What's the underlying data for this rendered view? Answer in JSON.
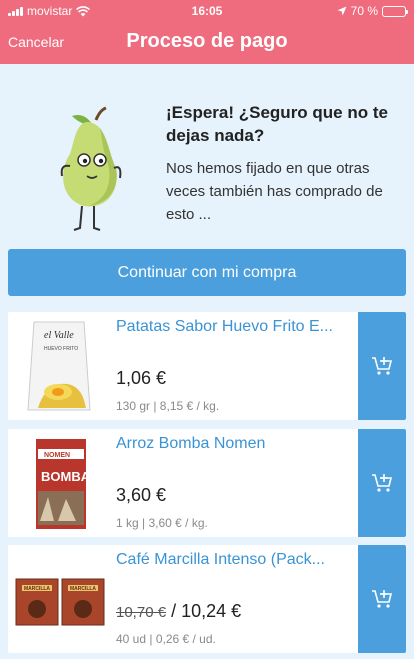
{
  "status": {
    "carrier": "movistar",
    "time": "16:05",
    "battery": "70 %",
    "battery_level": 0.7
  },
  "header": {
    "cancel": "Cancelar",
    "title": "Proceso de pago"
  },
  "intro": {
    "title": "¡Espera! ¿Seguro que no te dejas nada?",
    "text": "Nos hemos fijado en que otras veces también has comprado de esto ..."
  },
  "continue_label": "Continuar con mi compra",
  "products": [
    {
      "name": "Patatas Sabor Huevo Frito E...",
      "price": "1,06 €",
      "old_price": "",
      "unit": "130 gr | 8,15 € / kg.",
      "brand": "el Valle",
      "brand_sub": "HUEVO FRITO"
    },
    {
      "name": "Arroz Bomba Nomen",
      "price": "3,60 €",
      "old_price": "",
      "unit": "1 kg | 3,60 € / kg.",
      "brand": "NOMEN",
      "brand_sub": "BOMBA"
    },
    {
      "name": "Café Marcilla Intenso (Pack...",
      "price": "10,24 €",
      "old_price": "10,70 €",
      "unit": "40 ud | 0,26 € / ud.",
      "brand": "MARCILLA",
      "brand_sub": ""
    }
  ],
  "colors": {
    "brand": "#ef6b7e",
    "accent": "#4a9fdc",
    "background": "#e6f3fc"
  },
  "icons": {
    "add_to_cart": "cart-plus-icon",
    "signal": "signal-icon",
    "wifi": "wifi-icon",
    "location": "location-arrow-icon",
    "battery": "battery-icon"
  }
}
